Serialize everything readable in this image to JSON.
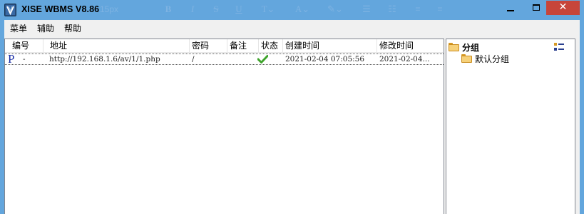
{
  "window": {
    "title": "XISE WBMS V8.86",
    "font_size_hint": "15px",
    "minimize_icon": "minimize-icon",
    "maximize_icon": "maximize-icon",
    "close_glyph": "✕"
  },
  "menubar": {
    "items": [
      "菜单",
      "辅助",
      "帮助"
    ]
  },
  "list": {
    "columns": [
      "编号",
      "地址",
      "密码",
      "备注",
      "状态",
      "创建时间",
      "修改时间"
    ],
    "rows": [
      {
        "type_glyph": "P",
        "id": "-",
        "address": "http://192.168.1.6/av/1/1.php",
        "password": "/",
        "note": "",
        "status_icon": "checkmark-icon",
        "created": "2021-02-04 07:05:56",
        "modified": "2021-02-04..."
      }
    ]
  },
  "groups": {
    "root_label": "分组",
    "children": [
      "默认分组"
    ]
  },
  "colors": {
    "titlebar": "#63a6dd",
    "close_button": "#c7453a",
    "status_ok": "#3ea32b",
    "folder": "#f6d17a"
  }
}
